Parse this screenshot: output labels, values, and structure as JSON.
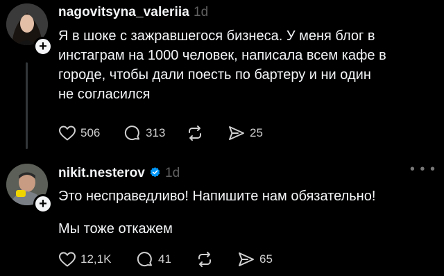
{
  "posts": [
    {
      "username": "nagovitsyna_valeriia",
      "time": "1d",
      "lines": [
        "Я в шоке с зажравшегося бизнеса. У меня блог в",
        "инстаграм на 1000 человек, написала всем кафе в",
        "городе, чтобы дали поесть по бартеру и ни один",
        "не согласился"
      ],
      "likes": "506",
      "comments": "313",
      "shares": "25",
      "icons": {
        "like": "heart-icon",
        "comment": "comment-icon",
        "repost": "repost-icon",
        "share": "share-icon"
      }
    },
    {
      "username": "nikit.nesterov",
      "time": "1d",
      "verified": true,
      "paragraph1": "Это несправедливо! Напишите нам обязательно!",
      "paragraph2": "Мы тоже откажем",
      "likes": "12,1K",
      "comments": "41",
      "shares": "65",
      "icons": {
        "like": "heart-icon",
        "comment": "comment-icon",
        "repost": "repost-icon",
        "share": "share-icon",
        "more": "more-icon"
      }
    }
  ],
  "colors": {
    "background": "#000000",
    "text": "#f3f5f7",
    "muted": "#616161",
    "verified": "#0095f6"
  }
}
